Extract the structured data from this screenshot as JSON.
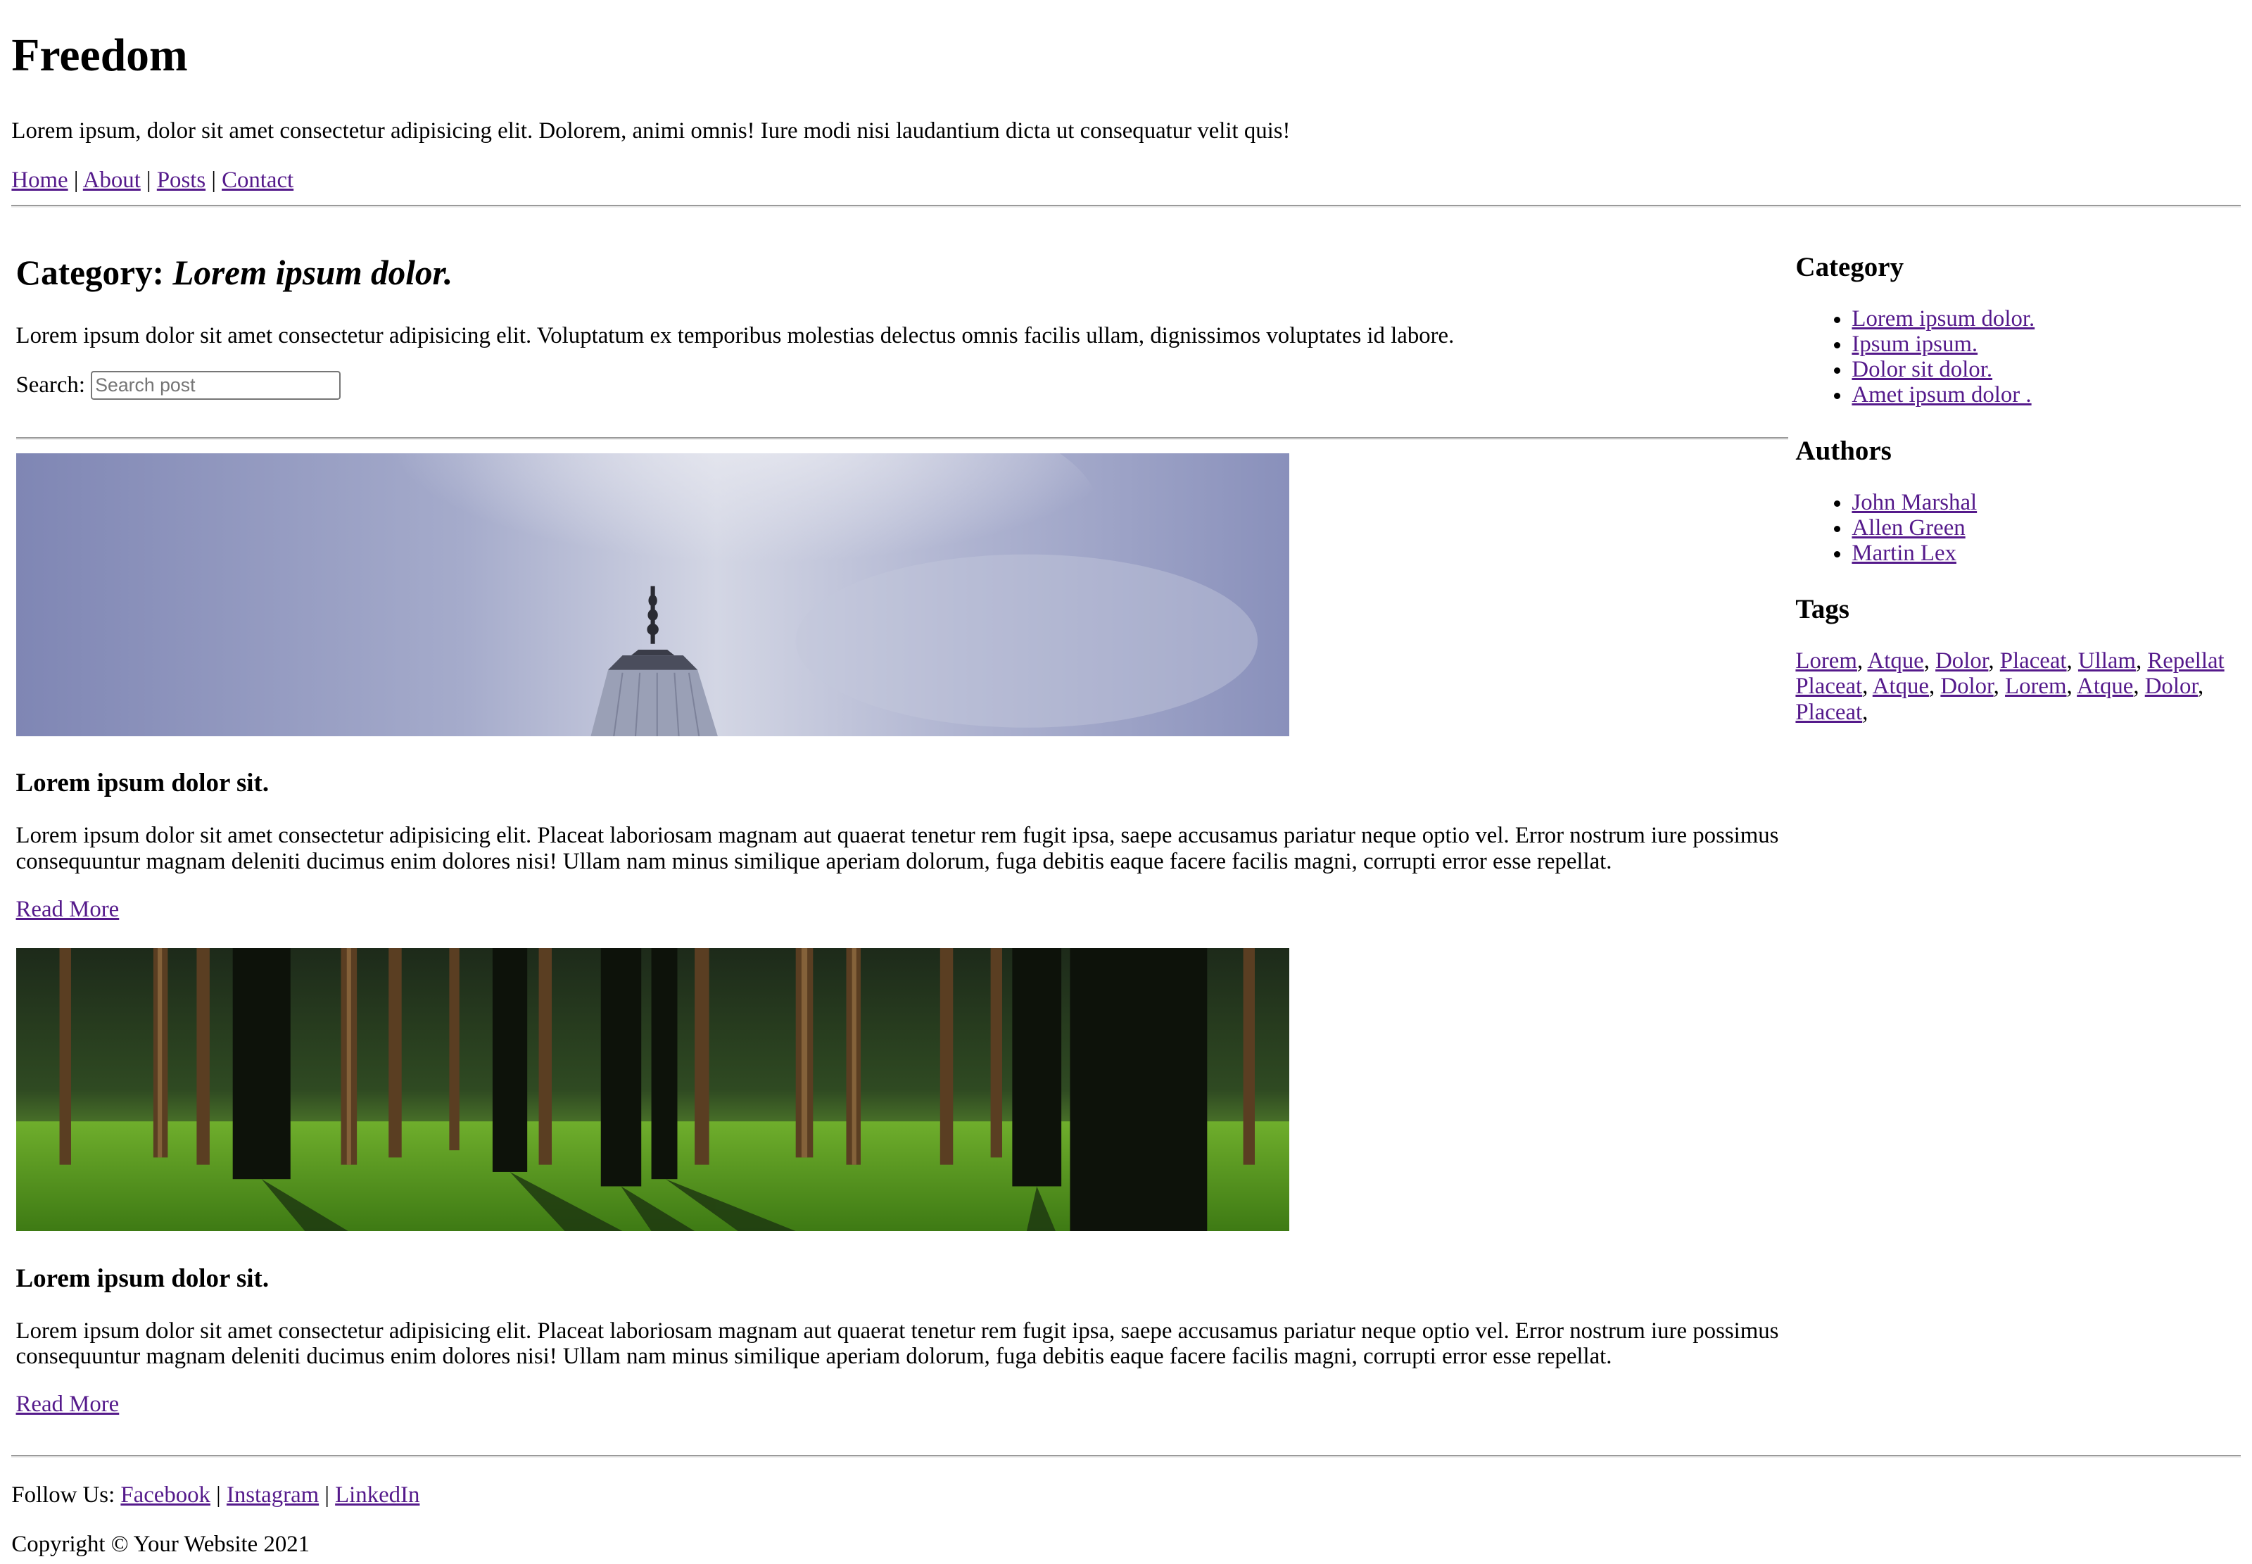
{
  "site": {
    "title": "Freedom",
    "tagline": "Lorem ipsum, dolor sit amet consectetur adipisicing elit. Dolorem, animi omnis! Iure modi nisi laudantium dicta ut consequatur velit quis!",
    "nav": [
      "Home",
      "About",
      "Posts",
      "Contact"
    ],
    "nav_separator": "|"
  },
  "main": {
    "category_prefix": "Category:",
    "category_name": "Lorem ipsum dolor.",
    "description": "Lorem ipsum dolor sit amet consectetur adipisicing elit. Voluptatum ex temporibus molestias delectus omnis facilis ullam, dignissimos voluptates id labore.",
    "search_label": "Search:",
    "search_placeholder": "Search post",
    "posts": [
      {
        "image": "city-tower-sky-photo",
        "title": "Lorem ipsum dolor sit.",
        "body": "Lorem ipsum dolor sit amet consectetur adipisicing elit. Placeat laboriosam magnam aut quaerat tenetur rem fugit ipsa, saepe accusamus pariatur neque optio vel. Error nostrum iure possimus consequuntur magnam deleniti ducimus enim dolores nisi! Ullam nam minus similique aperiam dolorum, fuga debitis eaque facere facilis magni, corrupti error esse repellat.",
        "link": "Read More"
      },
      {
        "image": "forest-photo",
        "title": "Lorem ipsum dolor sit.",
        "body": "Lorem ipsum dolor sit amet consectetur adipisicing elit. Placeat laboriosam magnam aut quaerat tenetur rem fugit ipsa, saepe accusamus pariatur neque optio vel. Error nostrum iure possimus consequuntur magnam deleniti ducimus enim dolores nisi! Ullam nam minus similique aperiam dolorum, fuga debitis eaque facere facilis magni, corrupti error esse repellat.",
        "link": "Read More"
      }
    ]
  },
  "sidebar": {
    "category_heading": "Category",
    "categories": [
      "Lorem ipsum dolor.",
      "Ipsum ipsum.",
      "Dolor sit dolor.",
      "Amet ipsum dolor ."
    ],
    "authors_heading": "Authors",
    "authors": [
      "John Marshal",
      "Allen Green",
      "Martin Lex"
    ],
    "tags_heading": "Tags",
    "tags": [
      "Lorem",
      "Atque",
      "Dolor",
      "Placeat",
      "Ullam",
      "Repellat",
      "Placeat",
      "Atque",
      "Dolor",
      "Lorem",
      "Atque",
      "Dolor",
      "Placeat"
    ]
  },
  "footer": {
    "follow_label": "Follow Us:",
    "social": [
      "Facebook",
      "Instagram",
      "LinkedIn"
    ],
    "copyright": "Copyright © Your Website 2021"
  },
  "colors": {
    "link": "#551a8b",
    "rule": "#9a9a9a"
  }
}
